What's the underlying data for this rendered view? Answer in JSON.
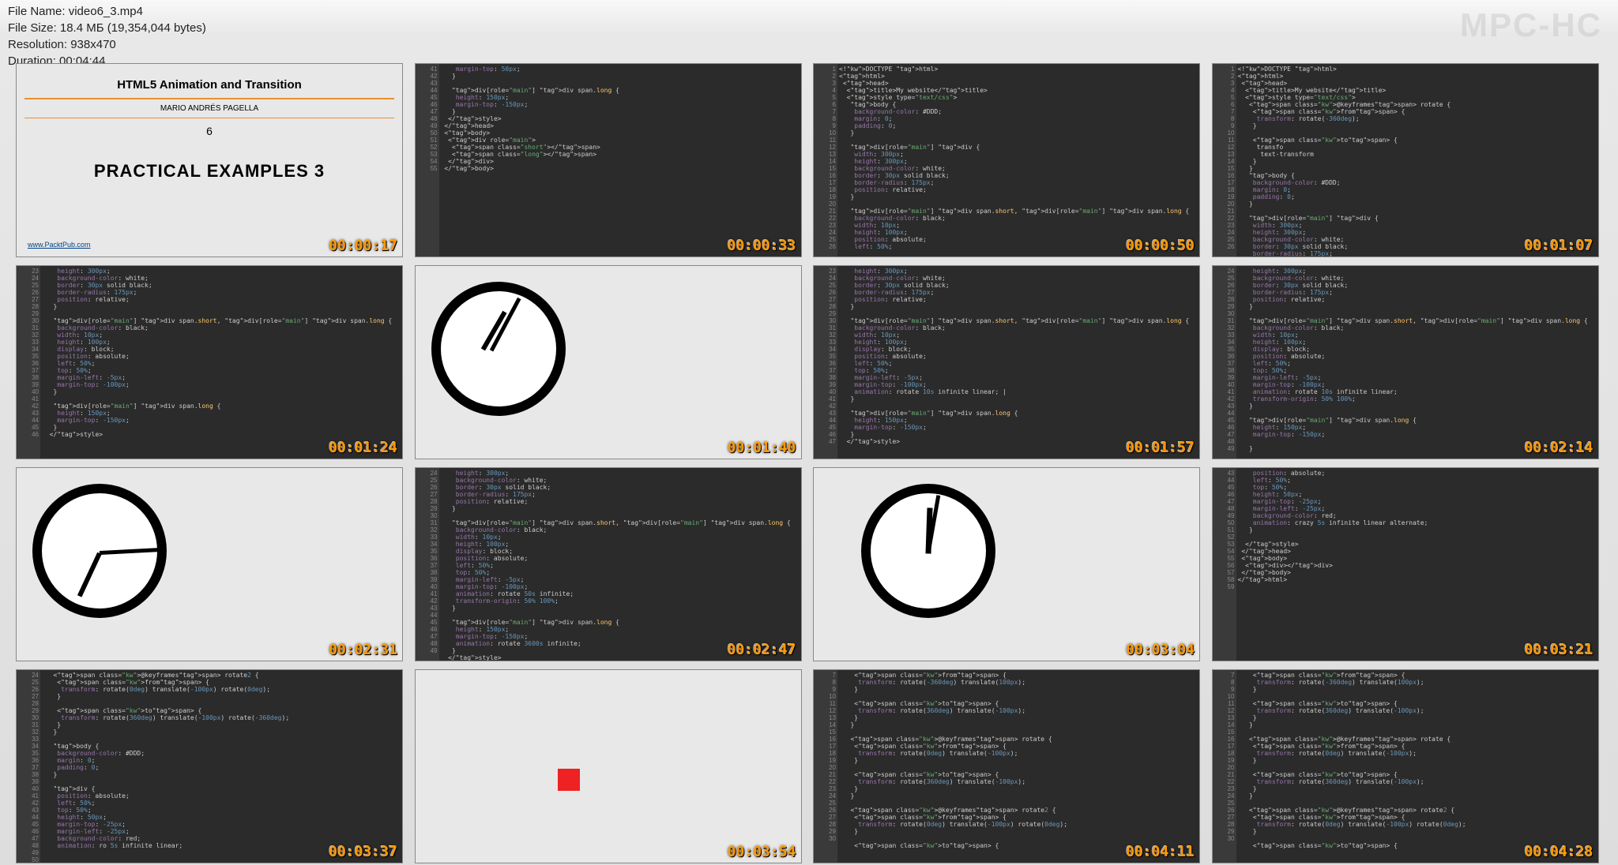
{
  "watermark": "MPC-HC",
  "file_info": {
    "name_label": "File Name:",
    "name": "video6_3.mp4",
    "size_label": "File Size:",
    "size": "18.4 МБ (19,354,044 bytes)",
    "resolution_label": "Resolution:",
    "resolution": "938x470",
    "duration_label": "Duration:",
    "duration": "00:04:44"
  },
  "slide": {
    "title": "HTML5 Animation and Transition",
    "author": "MARIO ANDRÉS PAGELLA",
    "number": "6",
    "heading": "PRACTICAL EXAMPLES 3",
    "footer": "www.PacktPub.com"
  },
  "timestamps": [
    "00:00:17",
    "00:00:33",
    "00:00:50",
    "00:01:07",
    "00:01:24",
    "00:01:40",
    "00:01:57",
    "00:02:14",
    "00:02:31",
    "00:02:47",
    "00:03:04",
    "00:03:21",
    "00:03:37",
    "00:03:54",
    "00:04:11",
    "00:04:28"
  ],
  "code_samples": {
    "a": "    margin-top: 50px;\n   }\n\n   div[role=\"main\"] div span.long {\n    height: 150px;\n    margin-top: -150px;\n   }\n  </style>\n </head>\n <body>\n  <div role=\"main\">\n   <span class=\"short\"></span>\n   <span class=\"long\"></span>\n  </div>\n </body>",
    "b": "<!DOCTYPE html>\n<html>\n <head>\n  <title>My website</title>\n  <style type=\"text/css\">\n   body {\n    background-color: #DDD;\n    margin: 0;\n    padding: 0;\n   }\n\n   div[role=\"main\"] div {\n    width: 300px;\n    height: 300px;\n    background-color: white;\n    border: 30px solid black;\n    border-radius: 175px;\n    position: relative;\n   }\n\n   div[role=\"main\"] div span.short, div[role=\"main\"] div span.long {\n    background-color: black;\n    width: 10px;\n    height: 100px;\n    position: absolute;\n    left: 50%;",
    "c": "<!DOCTYPE html>\n<html>\n <head>\n  <title>My website</title>\n  <style type=\"text/css\">\n   @keyframes rotate {\n    from {\n     transform: rotate(-360deg);\n    }\n\n    to {\n     transfo\n      text-transform\n    }\n   }\n   body {\n    background-color: #DDD;\n    margin: 0;\n    padding: 0;\n   }\n\n   div[role=\"main\"] div {\n    width: 300px;\n    height: 300px;\n    background-color: white;\n    border: 30px solid black;\n    border-radius: 175px;",
    "d": "    height: 300px;\n    background-color: white;\n    border: 30px solid black;\n    border-radius: 175px;\n    position: relative;\n   }\n\n   div[role=\"main\"] div span.short, div[role=\"main\"] div span.long {\n    background-color: black;\n    width: 10px;\n    height: 100px;\n    display: block;\n    position: absolute;\n    left: 50%;\n    top: 50%;\n    margin-left: -5px;\n    margin-top: -100px;\n   }\n\n   div[role=\"main\"] div span.long {\n    height: 150px;\n    margin-top: -150px;\n   }\n  </style>",
    "e": "    height: 300px;\n    background-color: white;\n    border: 30px solid black;\n    border-radius: 175px;\n    position: relative;\n   }\n\n   div[role=\"main\"] div span.short, div[role=\"main\"] div span.long {\n    background-color: black;\n    width: 10px;\n    height: 100px;\n    display: block;\n    position: absolute;\n    left: 50%;\n    top: 50%;\n    margin-left: -5px;\n    margin-top: -100px;\n    animation: rotate 10s infinite linear; |\n   }\n\n   div[role=\"main\"] div span.long {\n    height: 150px;\n    margin-top: -150px;\n   }\n  </style>",
    "f": "    height: 300px;\n    background-color: white;\n    border: 30px solid black;\n    border-radius: 175px;\n    position: relative;\n   }\n\n   div[role=\"main\"] div span.short, div[role=\"main\"] div span.long {\n    background-color: black;\n    width: 10px;\n    height: 100px;\n    display: block;\n    position: absolute;\n    left: 50%;\n    top: 50%;\n    margin-left: -5px;\n    margin-top: -100px;\n    animation: rotate 10s infinite linear;\n    transform-origin: 50% 100%;\n   }\n\n   div[role=\"main\"] div span.long {\n    height: 150px;\n    margin-top: -150px;\n    \n   }",
    "g": "    height: 300px;\n    background-color: white;\n    border: 30px solid black;\n    border-radius: 175px;\n    position: relative;\n   }\n\n   div[role=\"main\"] div span.short, div[role=\"main\"] div span.long {\n    background-color: black;\n    width: 10px;\n    height: 100px;\n    display: block;\n    position: absolute;\n    left: 50%;\n    top: 50%;\n    margin-left: -5px;\n    margin-top: -100px;\n    animation: rotate 50s infinite;\n    transform-origin: 50% 100%;\n   }\n\n   div[role=\"main\"] div span.long {\n    height: 150px;\n    margin-top: -150px;\n    animation: rotate 3600s infinite;\n   }\n  </style>",
    "h": "    position: absolute;\n    left: 50%;\n    top: 50%;\n    height: 50px;\n    margin-top: -25px;\n    margin-left: -25px;\n    background-color: red;\n    animation: crazy 5s infinite linear alternate;\n   }\n\n  </style>\n </head>\n <body>\n  <div></div>\n </body>\n</html>",
    "i": "   @keyframes rotate2 {\n    from {\n     transform: rotate(0deg) translate(-100px) rotate(0deg);\n    }\n\n    to {\n     transform: rotate(360deg) translate(-100px) rotate(-360deg);\n    }\n   }\n\n   body {\n    background-color: #DDD;\n    margin: 0;\n    padding: 0;\n   }\n\n   div {\n    position: absolute;\n    left: 50%;\n    top: 50%;\n    height: 50px;\n    margin-top: -25px;\n    margin-left: -25px;\n    background-color: red;\n    animation: ro 5s infinite linear;",
    "j": "    from {\n     transform: rotate(-360deg) translate(100px);\n    }\n\n    to {\n     transform: rotate(360deg) translate(-100px);\n    }\n   }\n\n   @keyframes rotate {\n    from {\n     transform: rotate(0deg) translate(-100px);\n    }\n\n    to {\n     transform: rotate(360deg) translate(-100px);\n    }\n   }\n\n   @keyframes rotate2 {\n    from {\n     transform: rotate(0deg) translate(-100px) rotate(0deg);\n    }\n\n    to {"
  }
}
